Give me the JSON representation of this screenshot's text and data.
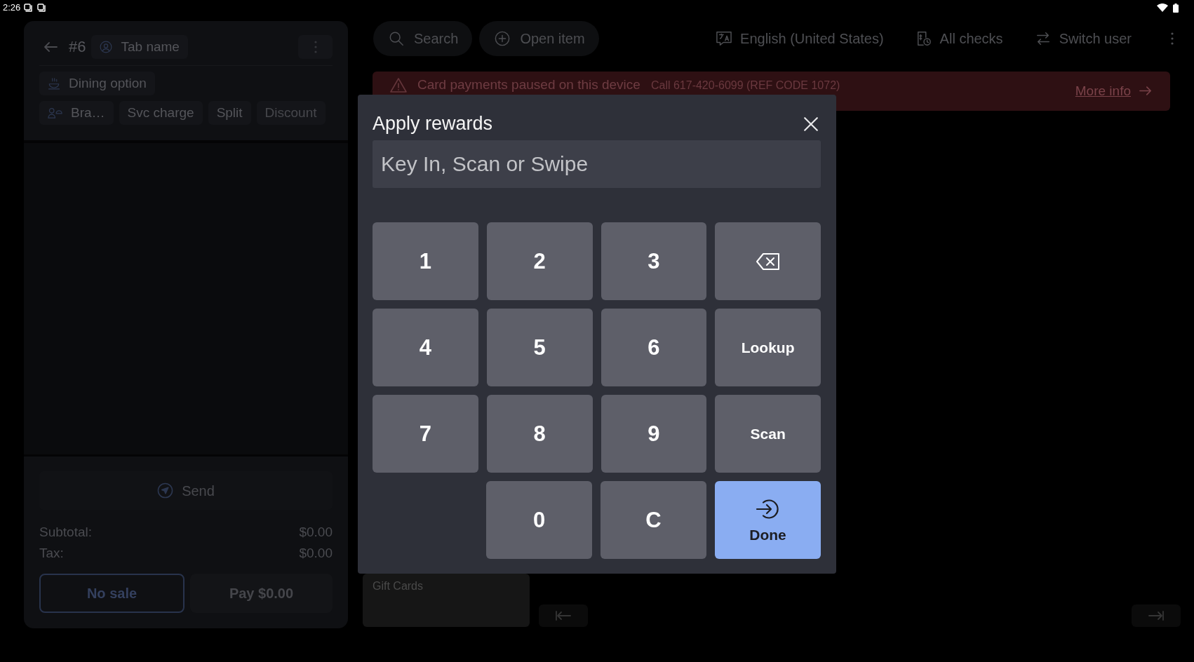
{
  "status_bar": {
    "time": "2:26"
  },
  "order_panel": {
    "check_number": "#6",
    "tab_name": "Tab name",
    "dining_option": "Dining option",
    "actions": [
      {
        "label": "Bra…",
        "disabled": false
      },
      {
        "label": "Svc charge",
        "disabled": false
      },
      {
        "label": "Split",
        "disabled": false
      },
      {
        "label": "Discount",
        "disabled": true
      }
    ],
    "send_button": "Send",
    "totals": [
      {
        "label": "Subtotal:",
        "value": "$0.00"
      },
      {
        "label": "Tax:",
        "value": "$0.00"
      }
    ],
    "buttons": [
      {
        "label": "No sale",
        "kind": "outline",
        "disabled": false
      },
      {
        "label": "Pay $0.00",
        "kind": "filled",
        "disabled": true
      }
    ]
  },
  "toolbar": {
    "left": [
      {
        "label": "Search"
      },
      {
        "label": "Open item"
      }
    ],
    "right": [
      {
        "label": "English (United States)"
      },
      {
        "label": "All checks"
      },
      {
        "label": "Switch user"
      }
    ]
  },
  "alert_banner": {
    "title": "Card payments paused on this device",
    "detail": "Call 617-420-6099 (REF CODE 1072)",
    "link": "More info"
  },
  "menu_tiles": [
    {
      "label": "Gift Cards"
    }
  ],
  "dialog": {
    "title": "Apply rewards",
    "input": {
      "placeholder": "Key In, Scan or Swipe"
    },
    "keypad_rows": [
      [
        {
          "kind": "digit",
          "label": "1"
        },
        {
          "kind": "digit",
          "label": "2"
        },
        {
          "kind": "digit",
          "label": "3"
        },
        {
          "kind": "backspace"
        }
      ],
      [
        {
          "kind": "digit",
          "label": "4"
        },
        {
          "kind": "digit",
          "label": "5"
        },
        {
          "kind": "digit",
          "label": "6"
        },
        {
          "kind": "action",
          "label": "Lookup"
        }
      ],
      [
        {
          "kind": "digit",
          "label": "7"
        },
        {
          "kind": "digit",
          "label": "8"
        },
        {
          "kind": "digit",
          "label": "9"
        },
        {
          "kind": "action",
          "label": "Scan"
        }
      ],
      [
        {
          "kind": "digit",
          "label": "0"
        },
        {
          "kind": "digit",
          "label": "C"
        },
        {
          "kind": "primary",
          "label": "Done"
        }
      ]
    ]
  }
}
